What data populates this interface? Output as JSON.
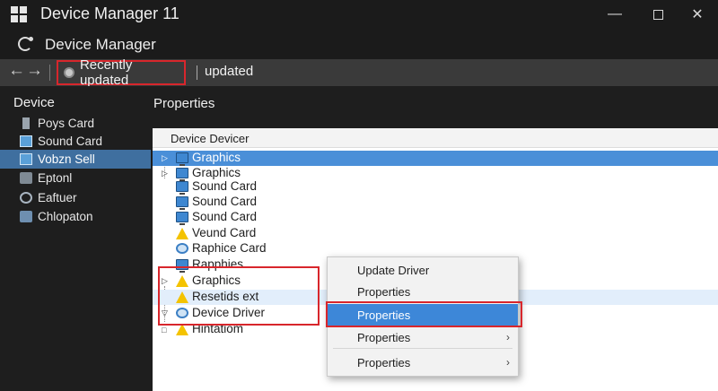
{
  "window": {
    "title": "Device Manager 11",
    "min_glyph": "—",
    "close_glyph": "✕"
  },
  "app_header": {
    "title": "Device Manager"
  },
  "toolbar": {
    "back_glyph": "←",
    "forward_glyph": "→",
    "tabs": [
      {
        "label": "Recently updated",
        "highlighted": true
      },
      {
        "label": "updated"
      }
    ]
  },
  "sidebar": {
    "heading": "Device",
    "items": [
      {
        "label": "Poys Card",
        "icon": "card-icon"
      },
      {
        "label": "Sound Card",
        "icon": "monitor-icon"
      },
      {
        "label": "Vobzn Sell",
        "icon": "monitor-icon",
        "selected": true
      },
      {
        "label": "Eptonl",
        "icon": "plug-icon"
      },
      {
        "label": "Eaftuer",
        "icon": "gear-icon"
      },
      {
        "label": "Chlopaton",
        "icon": "network-icon"
      }
    ]
  },
  "main": {
    "title": "Properties",
    "column_header": "Device Devicer",
    "rows": [
      {
        "label": "Graphics",
        "icon": "monitor-icon",
        "selected": true,
        "expander": "▷"
      },
      {
        "label": "Graphics",
        "icon": "monitor-icon",
        "expander": "▷"
      },
      {
        "label": "Sound Card",
        "icon": "monitor-icon"
      },
      {
        "label": "Sound Card",
        "icon": "monitor-icon"
      },
      {
        "label": "Sound Card",
        "icon": "monitor-icon"
      },
      {
        "label": "Veund Card",
        "icon": "warning-icon"
      },
      {
        "label": "Raphice Card",
        "icon": "gear-icon"
      },
      {
        "label": "Rapphies",
        "icon": "monitor-icon"
      },
      {
        "label": "Graphics",
        "icon": "warning-icon",
        "expander": "▷"
      },
      {
        "label": "Resetids ext",
        "icon": "warning-icon",
        "light": true
      },
      {
        "label": "Device Driver",
        "icon": "gear-icon",
        "expander": "▽"
      },
      {
        "label": "Hintatiom",
        "icon": "warning-icon",
        "expander": "□"
      }
    ]
  },
  "context_menu": {
    "items": [
      {
        "label": "Update Driver"
      },
      {
        "label": "Properties"
      },
      {
        "label": "Properties",
        "selected": true,
        "highlighted": true
      },
      {
        "label": "Properties",
        "submenu": true
      },
      {
        "label": "Properties",
        "submenu": true
      }
    ],
    "submenu_glyph": "›"
  },
  "colors": {
    "accent": "#3d87d8",
    "highlight_box": "#d8262c",
    "sidebar_selected": "#3f6f9f",
    "toolbar_bg": "#3a3a3a",
    "warning": "#f4c300"
  }
}
